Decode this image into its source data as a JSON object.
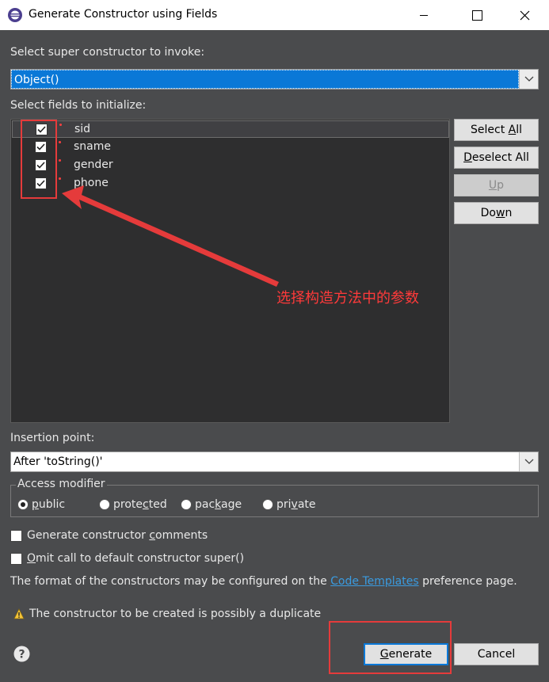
{
  "window": {
    "title": "Generate Constructor using Fields",
    "controls": {
      "minimize_icon": "minimize-icon",
      "maximize_icon": "maximize-icon",
      "close_icon": "close-icon"
    }
  },
  "super": {
    "label": "Select super constructor to invoke:",
    "value": "Object()"
  },
  "fields": {
    "label": "Select fields to initialize:",
    "items": [
      {
        "name": "sid",
        "checked": true
      },
      {
        "name": "sname",
        "checked": true
      },
      {
        "name": "gender",
        "checked": true
      },
      {
        "name": "phone",
        "checked": true
      }
    ]
  },
  "side_buttons": {
    "select_all_pre": "Select ",
    "select_all_u": "A",
    "select_all_post": "ll",
    "deselect_all_u": "D",
    "deselect_all_post": "eselect All",
    "up_u": "U",
    "up_post": "p",
    "down_pre": "Do",
    "down_u": "w",
    "down_post": "n"
  },
  "insertion": {
    "label": "Insertion point:",
    "value": "After 'toString()'"
  },
  "access": {
    "legend": "Access modifier",
    "options": [
      {
        "pre": "",
        "u": "p",
        "post": "ublic",
        "selected": true
      },
      {
        "pre": "prote",
        "u": "c",
        "post": "ted",
        "selected": false
      },
      {
        "pre": "pac",
        "u": "k",
        "post": "age",
        "selected": false
      },
      {
        "pre": "pri",
        "u": "v",
        "post": "ate",
        "selected": false
      }
    ]
  },
  "options": {
    "gen_comments_pre": "Generate constructor ",
    "gen_comments_u": "c",
    "gen_comments_post": "omments",
    "omit_super_u": "O",
    "omit_super_post": "mit call to default constructor super()"
  },
  "info": {
    "pre": "The format of the constructors may be configured on the ",
    "link": "Code Templates",
    "post": " preference page."
  },
  "warning": {
    "icon": "warning-icon",
    "text": "The constructor to be created is possibly a duplicate"
  },
  "footer": {
    "help_icon": "help-icon",
    "generate_u": "G",
    "generate_post": "enerate",
    "cancel": "Cancel"
  },
  "annotation": {
    "text": "选择构造方法中的参数",
    "color": "#e53b3b"
  },
  "colors": {
    "accent": "#0a78d7",
    "background": "#4a4b4d",
    "annotation": "#e53b3b"
  }
}
